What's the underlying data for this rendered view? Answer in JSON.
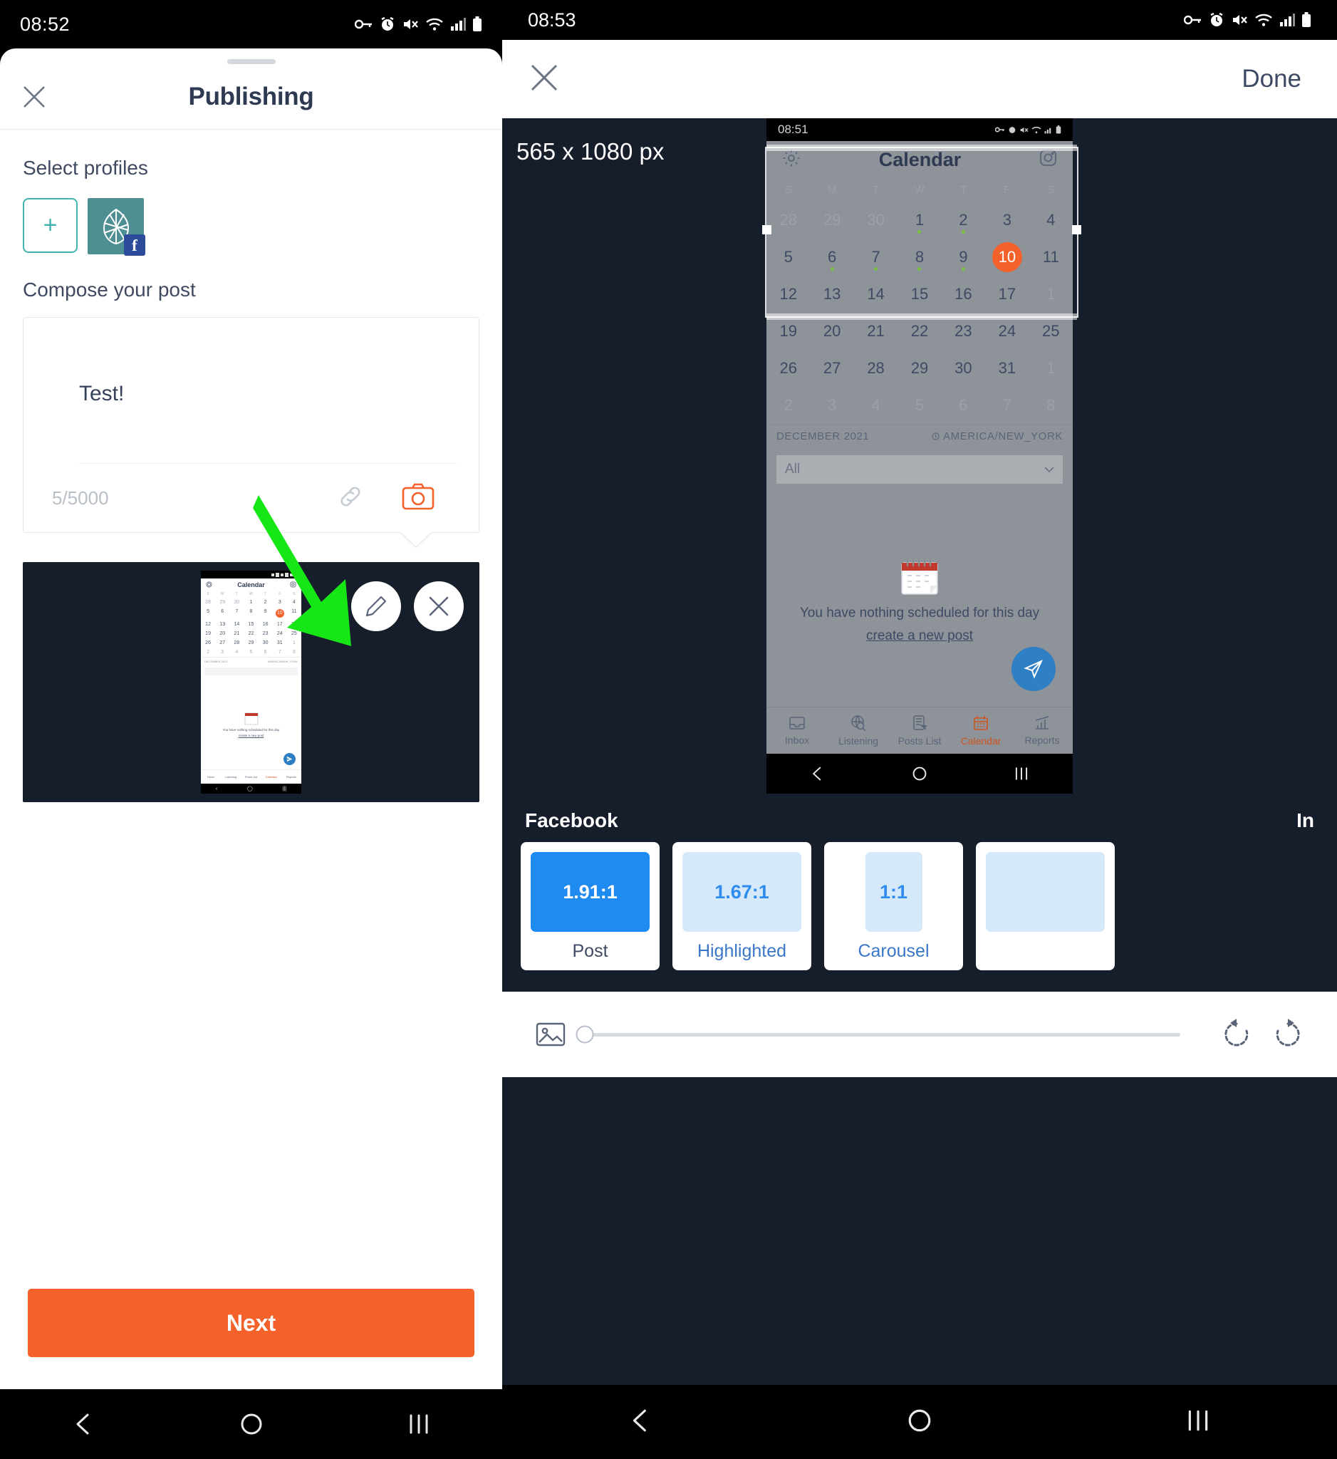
{
  "left": {
    "status": {
      "time": "08:52",
      "icons": [
        "key-icon",
        "alarm-icon",
        "mute-icon",
        "wifi-icon",
        "signal-icon",
        "battery-icon"
      ]
    },
    "sheet_title": "Publishing",
    "close_icon": "close-icon",
    "select_profiles_label": "Select profiles",
    "add_profile_label": "+",
    "profile_network_badge": "f",
    "compose_label": "Compose your post",
    "compose_text": "Test!",
    "char_count": "5/5000",
    "compose_icons": [
      "link-icon",
      "camera-icon"
    ],
    "media_actions": [
      "edit-pencil-icon",
      "remove-close-icon"
    ],
    "next_label": "Next",
    "navbar": [
      "back-icon",
      "home-icon",
      "recents-icon"
    ]
  },
  "right": {
    "status": {
      "time": "08:53",
      "icons": [
        "key-icon",
        "alarm-icon",
        "mute-icon",
        "wifi-icon",
        "signal-icon",
        "battery-icon"
      ]
    },
    "close_icon": "close-icon",
    "done_label": "Done",
    "dimensions_label": "565 x 1080 px",
    "preview": {
      "status_time": "08:51",
      "appbar": {
        "settings_icon": "gear-icon",
        "title": "Calendar",
        "instagram_icon": "instagram-icon"
      },
      "weekday_headers": [
        "S",
        "M",
        "T",
        "W",
        "T",
        "F",
        "S"
      ],
      "weeks": [
        [
          {
            "d": "28",
            "dim": true
          },
          {
            "d": "29",
            "dim": true
          },
          {
            "d": "30",
            "dim": true
          },
          {
            "d": "1",
            "dot": true
          },
          {
            "d": "2",
            "dot": true
          },
          {
            "d": "3"
          },
          {
            "d": "4"
          }
        ],
        [
          {
            "d": "5"
          },
          {
            "d": "6",
            "dot": true
          },
          {
            "d": "7",
            "dot": true
          },
          {
            "d": "8",
            "dot": true
          },
          {
            "d": "9",
            "dot": true
          },
          {
            "d": "10",
            "today": true
          },
          {
            "d": "11"
          }
        ],
        [
          {
            "d": "12"
          },
          {
            "d": "13"
          },
          {
            "d": "14"
          },
          {
            "d": "15"
          },
          {
            "d": "16"
          },
          {
            "d": "17"
          },
          {
            "d": "1",
            "dim": true
          }
        ],
        [
          {
            "d": "19"
          },
          {
            "d": "20"
          },
          {
            "d": "21"
          },
          {
            "d": "22"
          },
          {
            "d": "23"
          },
          {
            "d": "24"
          },
          {
            "d": "25"
          }
        ],
        [
          {
            "d": "26"
          },
          {
            "d": "27"
          },
          {
            "d": "28"
          },
          {
            "d": "29"
          },
          {
            "d": "30"
          },
          {
            "d": "31"
          },
          {
            "d": "1",
            "dim": true
          }
        ],
        [
          {
            "d": "2",
            "dim": true
          },
          {
            "d": "3",
            "dim": true
          },
          {
            "d": "4",
            "dim": true
          },
          {
            "d": "5",
            "dim": true
          },
          {
            "d": "6",
            "dim": true
          },
          {
            "d": "7",
            "dim": true
          },
          {
            "d": "8",
            "dim": true
          }
        ]
      ],
      "month_label": "DECEMBER 2021",
      "timezone_label": "AMERICA/NEW_YORK",
      "filter_value": "All",
      "empty_text": "You have nothing scheduled for this day",
      "empty_link": "create a new post",
      "fab_icon": "send-icon",
      "bottom_nav": [
        {
          "label": "Inbox",
          "icon": "inbox-icon",
          "active": false
        },
        {
          "label": "Listening",
          "icon": "listening-globe-icon",
          "active": false
        },
        {
          "label": "Posts List",
          "icon": "posts-list-icon",
          "active": false
        },
        {
          "label": "Calendar",
          "icon": "calendar-icon",
          "active": true
        },
        {
          "label": "Reports",
          "icon": "reports-chart-icon",
          "active": false
        }
      ],
      "navbar": [
        "back-icon",
        "home-icon",
        "recents-icon"
      ]
    },
    "ratio_groups": {
      "primary": "Facebook",
      "secondary": "In"
    },
    "ratio_cards": [
      {
        "ratio": "1.91:1",
        "caption": "Post",
        "selected": true,
        "shape": "wide"
      },
      {
        "ratio": "1.67:1",
        "caption": "Highlighted",
        "selected": false,
        "shape": "wide"
      },
      {
        "ratio": "1:1",
        "caption": "Carousel",
        "selected": false,
        "shape": "tall"
      },
      {
        "ratio": "",
        "caption": "",
        "selected": false,
        "shape": "wide"
      }
    ],
    "tools": {
      "image_icon": "image-icon",
      "zoom_slider_value": 0,
      "rotate_left_icon": "rotate-ccw-icon",
      "rotate_right_icon": "rotate-cw-icon"
    },
    "navbar": [
      "back-icon",
      "home-icon",
      "recents-icon"
    ]
  },
  "annotation": {
    "arrow_color": "#16e616"
  }
}
